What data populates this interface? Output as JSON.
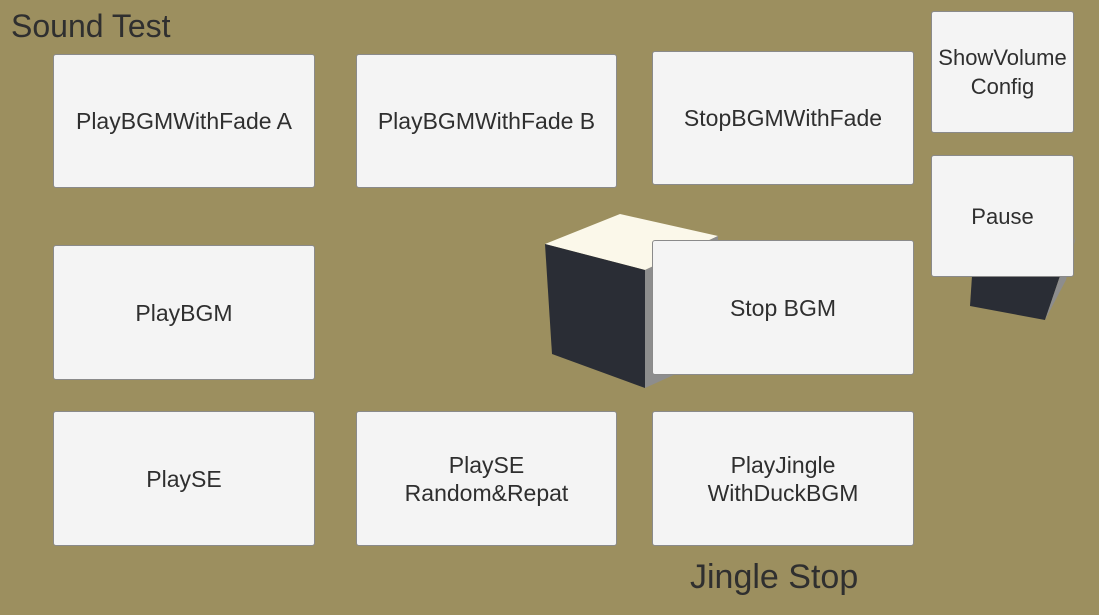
{
  "scene": {
    "background_color": "#9c8f5f",
    "title": "Sound Test",
    "status_text": "Jingle Stop"
  },
  "buttons": {
    "play_bgm_fade_a": "PlayBGMWithFade A",
    "play_bgm_fade_b": "PlayBGMWithFade B",
    "stop_bgm_fade": "StopBGMWithFade",
    "show_volume_config": "ShowVolumeConfig",
    "pause": "Pause",
    "play_bgm": "PlayBGM",
    "stop_bgm": "Stop BGM",
    "play_se": "PlaySE",
    "play_se_random": "PlaySE\nRandom&Repat",
    "play_jingle": "PlayJingle\nWithDuckBGM"
  },
  "cubes": [
    {
      "name": "cube-center",
      "top_color": "#fbf8ea",
      "front_color": "#2a2d35",
      "side_color": "#8d8d8d"
    },
    {
      "name": "cube-right",
      "front_color": "#2a2d35",
      "side_color": "#8d8d8d"
    }
  ]
}
